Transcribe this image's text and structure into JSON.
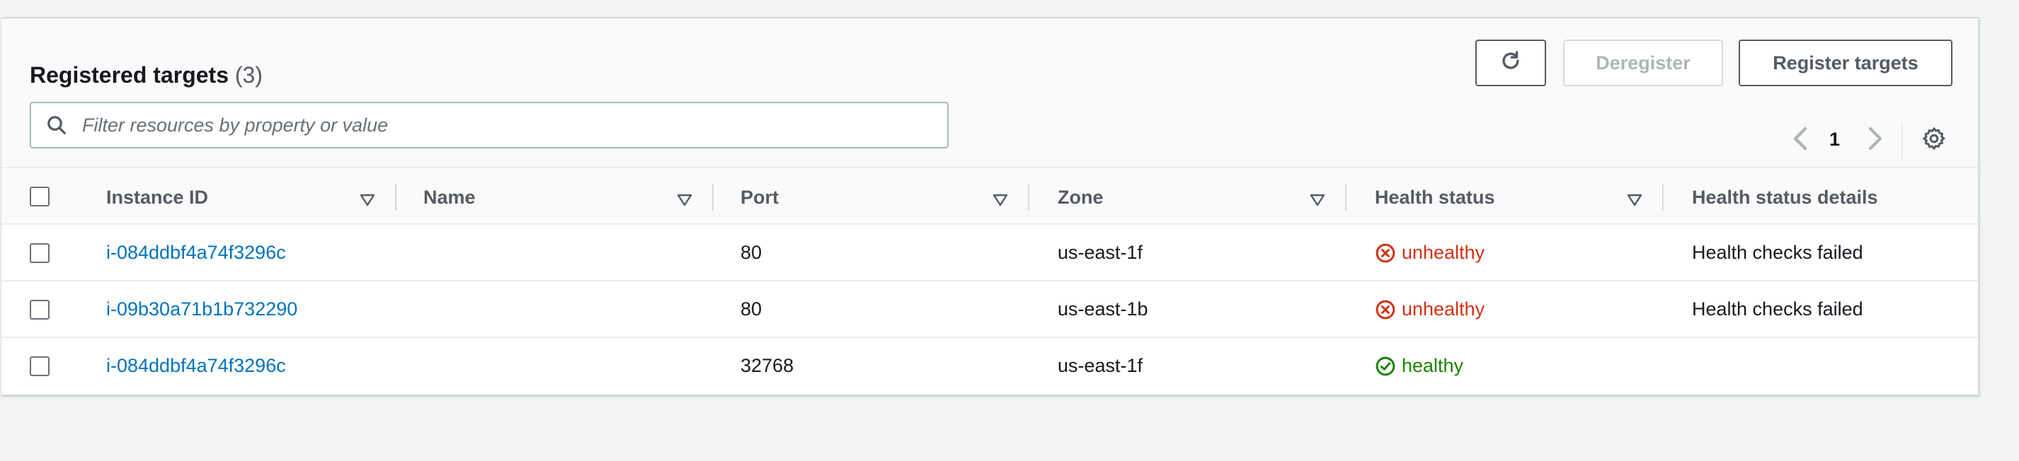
{
  "header": {
    "title": "Registered targets",
    "count": "(3)",
    "deregister_label": "Deregister",
    "register_label": "Register targets",
    "refresh_icon": "refresh-icon",
    "search_placeholder": "Filter resources by property or value",
    "page_number": "1"
  },
  "table": {
    "columns": [
      "Instance ID",
      "Name",
      "Port",
      "Zone",
      "Health status",
      "Health status details"
    ],
    "rows": [
      {
        "instance_id": "i-084ddbf4a74f3296c",
        "name": "",
        "port": "80",
        "zone": "us-east-1f",
        "health": "unhealthy",
        "details": "Health checks failed"
      },
      {
        "instance_id": "i-09b30a71b1b732290",
        "name": "",
        "port": "80",
        "zone": "us-east-1b",
        "health": "unhealthy",
        "details": "Health checks failed"
      },
      {
        "instance_id": "i-084ddbf4a74f3296c",
        "name": "",
        "port": "32768",
        "zone": "us-east-1f",
        "health": "healthy",
        "details": ""
      }
    ]
  },
  "colors": {
    "link": "#0073bb",
    "unhealthy": "#d13212",
    "healthy": "#1d8102"
  }
}
